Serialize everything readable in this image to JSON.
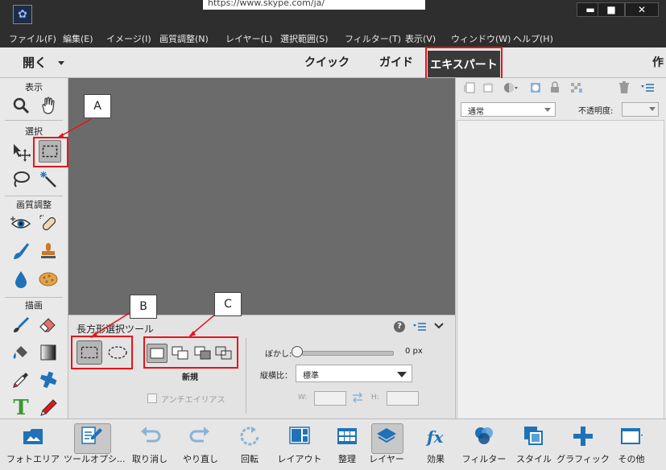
{
  "window": {
    "url": "https://www.skype.com/ja/",
    "minimize": "▬",
    "maximize": "■",
    "close": "✕"
  },
  "menu": [
    "ファイル(F)",
    "編集(E)",
    "イメージ(I)",
    "画質調整(N)",
    "レイヤー(L)",
    "選択範囲(S)",
    "フィルター(T)",
    "表示(V)",
    "ウィンドウ(W)",
    "ヘルプ(H)"
  ],
  "modes": {
    "open": "開く",
    "quick": "クイック",
    "guided": "ガイド",
    "expert": "エキスパート",
    "create": "作"
  },
  "toolbox": {
    "view": "表示",
    "select": "選択",
    "enhance": "画質調整",
    "draw": "描画"
  },
  "callouts": {
    "a": "A",
    "b": "B",
    "c": "C"
  },
  "options": {
    "title": "長方形選択ツール",
    "new_label": "新規",
    "antialias": "アンチエイリアス",
    "feather_label": "ぼかし:",
    "feather_value": "0 px",
    "feather_level": 0,
    "aspect_label": "縦横比：",
    "aspect_value": "標準",
    "w_label": "W:",
    "h_label": "H:"
  },
  "panel": {
    "blend_mode": "通常",
    "opacity_label": "不透明度:"
  },
  "bottombar": [
    {
      "label": "フォトエリア",
      "icon": "photo-bin-icon"
    },
    {
      "label": "ツールオプシ...",
      "icon": "tool-options-icon"
    },
    {
      "label": "取り消し",
      "icon": "undo-icon"
    },
    {
      "label": "やり直し",
      "icon": "redo-icon"
    },
    {
      "label": "回転",
      "icon": "rotate-icon"
    },
    {
      "label": "レイアウト",
      "icon": "layout-icon"
    },
    {
      "label": "整理",
      "icon": "organizer-icon"
    },
    {
      "label": "レイヤー",
      "icon": "layers-icon"
    },
    {
      "label": "効果",
      "icon": "effects-icon"
    },
    {
      "label": "フィルター",
      "icon": "filters-icon"
    },
    {
      "label": "スタイル",
      "icon": "styles-icon"
    },
    {
      "label": "グラフィック",
      "icon": "graphics-icon"
    },
    {
      "label": "その他",
      "icon": "more-icon"
    }
  ],
  "colors": {
    "accent_red": "#e8131a",
    "dark_bar": "#2e2e2e",
    "canvas": "#6b6b6b",
    "icon_blue": "#1f72b8"
  }
}
